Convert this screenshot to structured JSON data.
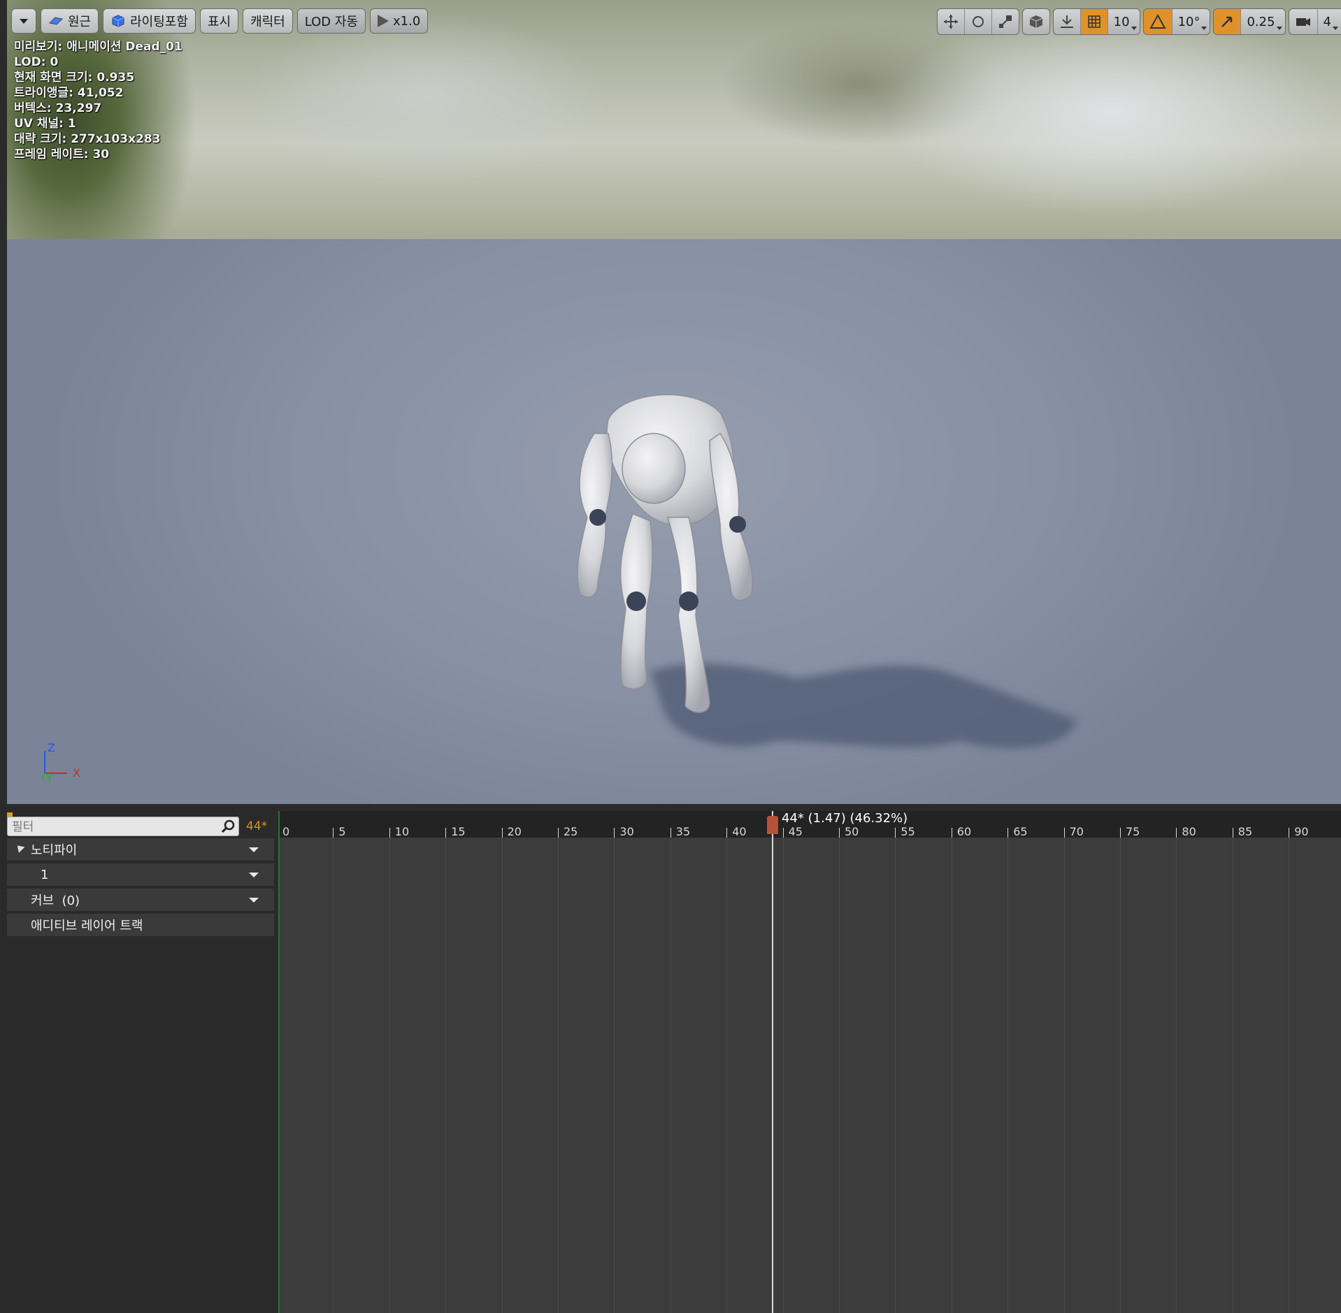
{
  "toolbar_left": {
    "menu_label": "",
    "perspective": "원근",
    "lighting": "라이팅포함",
    "show": "표시",
    "character": "캐릭터",
    "lod": "LOD 자동",
    "playback_speed": "x1.0"
  },
  "toolbar_right": {
    "grid_snap_value": "10",
    "rotation_snap_value": "10°",
    "scale_snap_value": "0.25",
    "camera_speed_value": "4"
  },
  "stats": [
    "미리보기: 애니메이션 Dead_01",
    "LOD: 0",
    "현재 화면 크기: 0.935",
    "트라이앵글: 41,052",
    "버텍스: 23,297",
    "UV 채널: 1",
    "대략 크기: 277x103x283",
    "프레임 레이트: 30"
  ],
  "axis": {
    "z": "Z",
    "y": "Y",
    "x": "X"
  },
  "timeline": {
    "filter_placeholder": "필터",
    "current_frame_badge": "44*",
    "playhead_label": "44* (1.47) (46.32%)",
    "tracks": [
      {
        "label": "노티파이"
      },
      {
        "label": "1"
      },
      {
        "label": "커브  (0)"
      },
      {
        "label": "애디티브 레이어 트랙"
      }
    ],
    "ticks": [
      "0",
      "5",
      "10",
      "15",
      "20",
      "25",
      "30",
      "35",
      "40",
      "45",
      "50",
      "55",
      "60",
      "65",
      "70",
      "75",
      "80",
      "85",
      "90"
    ]
  },
  "colors": {
    "snap_active": "#e0922a",
    "playhead_handle": "#b5523a",
    "start_marker": "#1f7a25",
    "frame_badge": "#e3901c"
  },
  "icons": {
    "menu": "chevron-down-icon",
    "perspective": "perspective-icon",
    "lighting": "lit-cube-icon",
    "play": "play-icon",
    "translate": "translate-icon",
    "rotate": "rotate-icon",
    "scale": "scale-icon",
    "world_local": "cube-icon",
    "surface_snap": "surface-snap-icon",
    "grid_snap": "grid-icon",
    "rotation_snap": "angle-icon",
    "scale_snap": "scale-snap-icon",
    "camera_speed": "camera-icon",
    "filter_search": "search-icon"
  }
}
